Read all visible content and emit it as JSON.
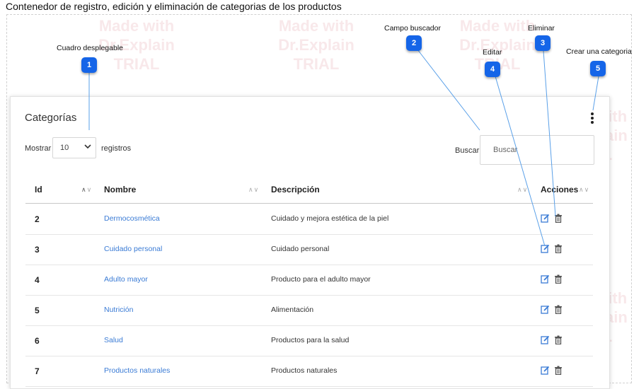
{
  "page": {
    "title": "Contenedor de registro, edición y eliminación de  categorias de los productos"
  },
  "watermark": {
    "line1": "Made with",
    "line2": "Dr.Explain",
    "line3": "TRIAL"
  },
  "card": {
    "title": "Categorías",
    "menu_icon": "kebab-vertical-icon"
  },
  "length": {
    "label_before": "Mostrar",
    "value": "10",
    "label_after": "registros",
    "icon": "chevron-down-icon"
  },
  "search": {
    "label": "Buscar",
    "placeholder": "Buscar",
    "value": ""
  },
  "table": {
    "columns": [
      "Id",
      "Nombre",
      "Descripción",
      "Acciones"
    ],
    "rows": [
      {
        "id": "2",
        "name": "Dermocosmética",
        "desc": "Cuidado y mejora estética de la piel"
      },
      {
        "id": "3",
        "name": "Cuidado personal",
        "desc": "Cuidado personal"
      },
      {
        "id": "4",
        "name": "Adulto mayor",
        "desc": "Producto para el adulto mayor"
      },
      {
        "id": "5",
        "name": "Nutrición",
        "desc": "Alimentación"
      },
      {
        "id": "6",
        "name": "Salud",
        "desc": "Productos para la salud"
      },
      {
        "id": "7",
        "name": "Productos naturales",
        "desc": "Productos naturales"
      }
    ],
    "action_icons": [
      "edit-icon",
      "trash-icon"
    ]
  },
  "callouts": [
    {
      "number": "1",
      "label": "Cuadro desplegable"
    },
    {
      "number": "2",
      "label": "Campo buscador"
    },
    {
      "number": "3",
      "label": "Eliminar"
    },
    {
      "number": "4",
      "label": "Editar"
    },
    {
      "number": "5",
      "label": "Crear una categoria"
    }
  ],
  "colors": {
    "link": "#3a7bd5",
    "badge": "#1565e8",
    "callout_line": "#5aa0e8"
  }
}
